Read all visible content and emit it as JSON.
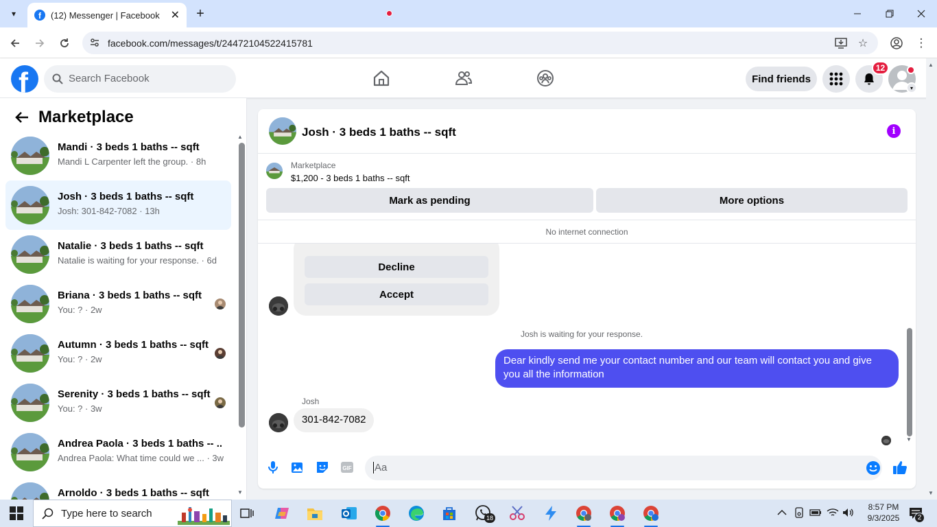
{
  "browser": {
    "tab_title": "(12) Messenger | Facebook",
    "tab_close": "✕",
    "new_tab": "+",
    "url": "facebook.com/messages/t/24472104522415781"
  },
  "facebook": {
    "search_placeholder": "Search Facebook",
    "find_friends": "Find friends",
    "notification_count": "12",
    "accent": "#1877f2"
  },
  "left_pane": {
    "title": "Marketplace",
    "conversations": [
      {
        "name": "Mandi · 3 beds 1 baths -- sqft",
        "preview": "Mandi L Carpenter left the group. · 8h",
        "active": false
      },
      {
        "name": "Josh · 3 beds 1 baths -- sqft",
        "preview": "Josh: 301-842-7082 · 13h",
        "active": true
      },
      {
        "name": "Natalie · 3 beds 1 baths -- sqft",
        "preview": "Natalie is waiting for your response. · 6d",
        "active": false
      },
      {
        "name": "Briana · 3 beds 1 baths -- sqft",
        "preview": "You: ? · 2w",
        "active": false
      },
      {
        "name": "Autumn · 3 beds 1 baths -- sqft",
        "preview": "You: ? · 2w",
        "active": false
      },
      {
        "name": "Serenity · 3 beds 1 baths -- sqft",
        "preview": "You: ? · 3w",
        "active": false
      },
      {
        "name": "Andrea Paola · 3 beds 1 baths -- ...",
        "preview": "Andrea Paola: What time could we ... · 3w",
        "active": false
      },
      {
        "name": "Arnoldo · 3 beds 1 baths -- sqft",
        "preview": "",
        "active": false
      }
    ]
  },
  "chat": {
    "title": "Josh · 3 beds 1 baths -- sqft",
    "listing_source": "Marketplace",
    "listing_price": "$1,200 - 3 beds 1 baths -- sqft",
    "mark_pending": "Mark as pending",
    "more_options": "More options",
    "connection_status": "No internet connection",
    "decline": "Decline",
    "accept": "Accept",
    "system_note": "Josh is waiting for your response.",
    "outgoing_message": "Dear kindly send me your contact number and our team will contact you and give you all the information",
    "sender_name": "Josh",
    "incoming_message": "301-842-7082",
    "composer_placeholder": "Aa",
    "outgoing_color": "#4e4ff0"
  },
  "taskbar": {
    "search_text": "Type here to search",
    "time": "8:57 PM",
    "date": "9/3/2025",
    "whatsapp_badge": "18",
    "notification_badge": "2"
  }
}
